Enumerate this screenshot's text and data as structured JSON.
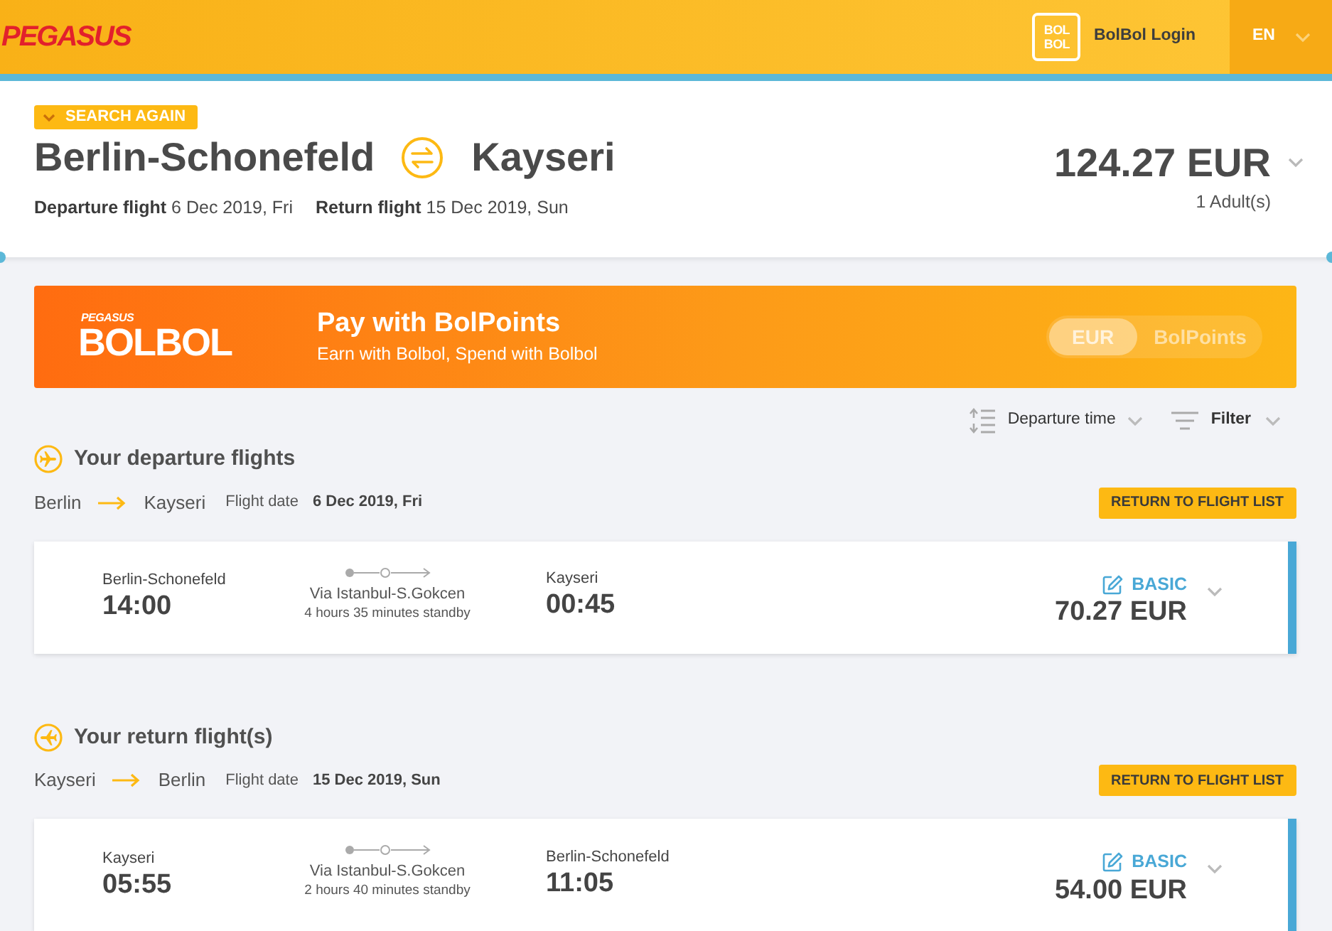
{
  "header": {
    "logo": "PEGASUS",
    "login_badge": [
      "BOL",
      "BOL"
    ],
    "login": "BolBol Login",
    "language": "EN"
  },
  "summary": {
    "search_again": "SEARCH AGAIN",
    "origin": "Berlin-Schonefeld",
    "destination": "Kayseri",
    "dates": [
      {
        "label": "Departure flight",
        "value": "6 Dec 2019, Fri"
      },
      {
        "label": "Return flight",
        "value": "15 Dec 2019, Sun"
      }
    ],
    "total": "124.27 EUR",
    "passengers": "1 Adult(s)"
  },
  "promo": {
    "brand": "PEGASUS",
    "logo": "BOLBOL",
    "title": "Pay with BolPoints",
    "subtitle": "Earn with Bolbol, Spend with Bolbol",
    "currency_toggle": [
      {
        "label": "EUR",
        "selected": true
      },
      {
        "label": "BolPoints",
        "selected": false
      }
    ]
  },
  "sort_bar": {
    "sort": "Departure time",
    "filter": "Filter"
  },
  "sections": [
    {
      "kind": "departure",
      "title": "Your departure flights",
      "from": "Berlin",
      "to": "Kayseri",
      "date_label": "Flight date",
      "date": "6 Dec 2019, Fri",
      "button": "RETURN TO FLIGHT LIST",
      "flight": {
        "origin": "Berlin-Schonefeld",
        "departure": "14:00",
        "via": "Via Istanbul-S.Gokcen",
        "standby": "4 hours 35 minutes standby",
        "destination": "Kayseri",
        "arrival": "00:45",
        "fare": "BASIC",
        "price": "70.27 EUR"
      }
    },
    {
      "kind": "return",
      "title": "Your return flight(s)",
      "from": "Kayseri",
      "to": "Berlin",
      "date_label": "Flight date",
      "date": "15 Dec 2019, Sun",
      "button": "RETURN TO FLIGHT LIST",
      "flight": {
        "origin": "Kayseri",
        "departure": "05:55",
        "via": "Via Istanbul-S.Gokcen",
        "standby": "2 hours 40 minutes standby",
        "destination": "Berlin-Schonefeld",
        "arrival": "11:05",
        "fare": "BASIC",
        "price": "54.00 EUR"
      }
    }
  ]
}
